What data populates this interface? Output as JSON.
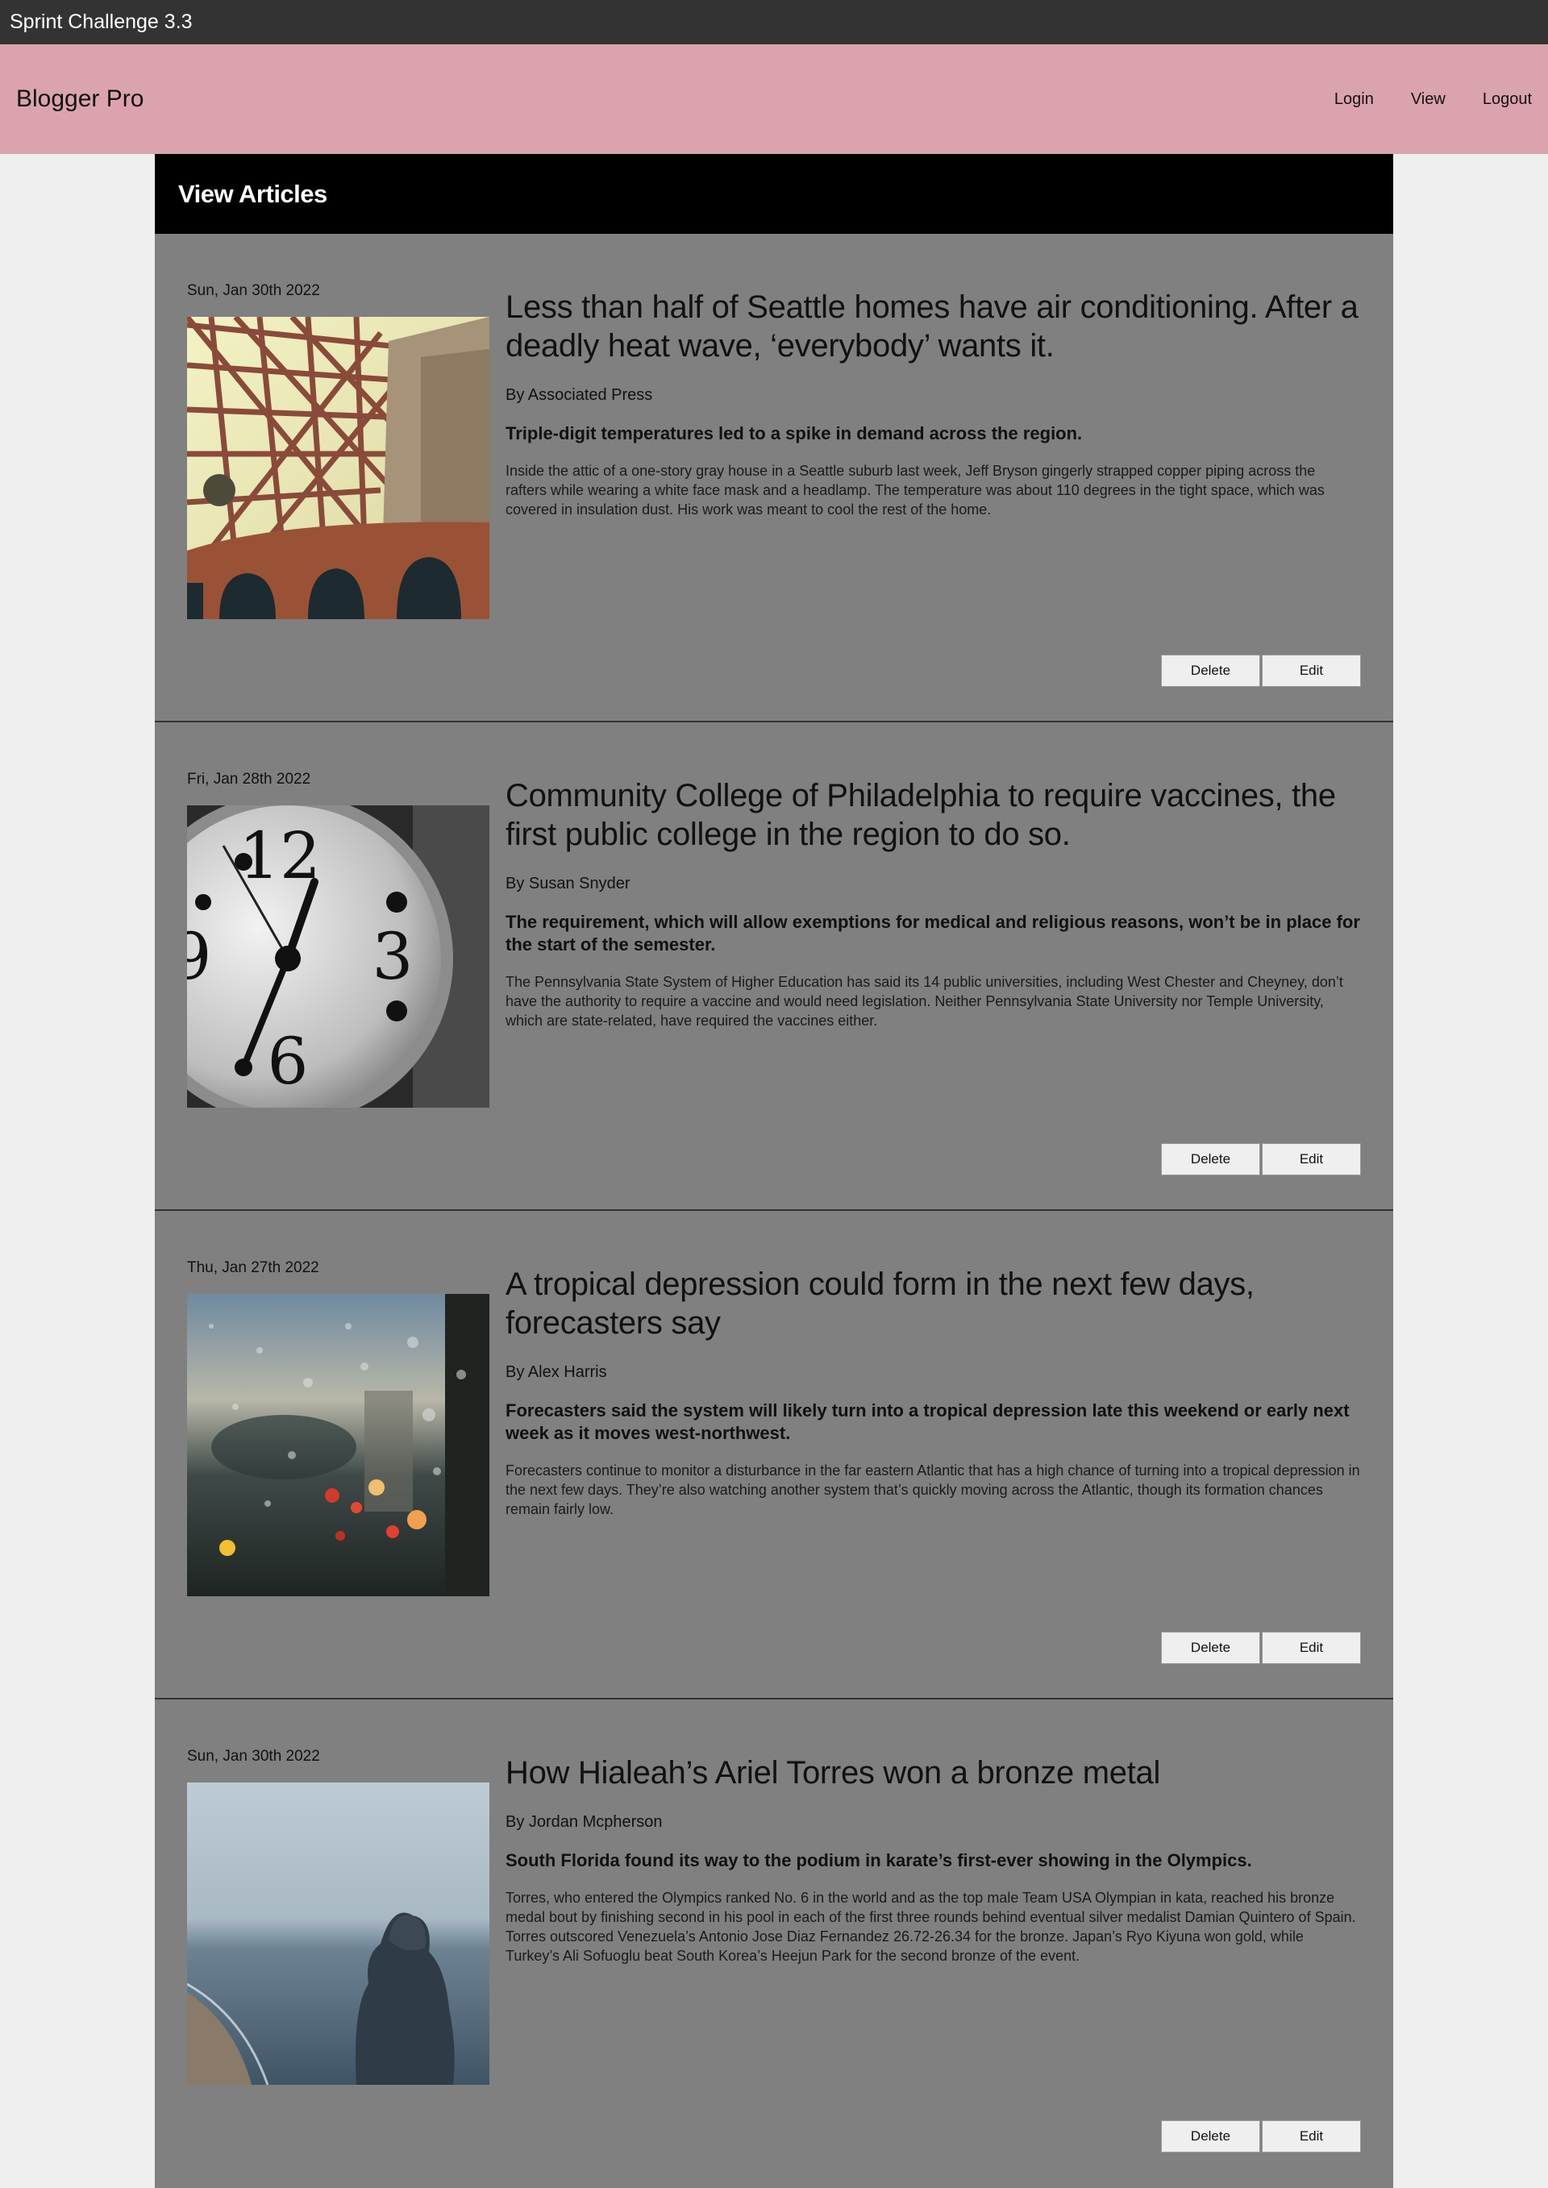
{
  "window": {
    "title": "Sprint Challenge 3.3"
  },
  "header": {
    "brand": "Blogger Pro",
    "nav": [
      "Login",
      "View",
      "Logout"
    ]
  },
  "panel": {
    "title": "View Articles"
  },
  "articles": [
    {
      "date": "Sun, Jan 30th 2022",
      "headline": "Less than half of Seattle homes have air conditioning. After a deadly heat wave, ‘everybody’ wants it.",
      "author": "By Associated Press",
      "summary": "Triple-digit temperatures led to a spike in demand across the region.",
      "body": "Inside the attic of a one-story gray house in a Seattle suburb last week, Jeff Bryson gingerly strapped copper piping across the rafters while wearing a white face mask and a headlamp. The temperature was about 110 degrees in the tight space, which was covered in insulation dust. His work was meant to cool the rest of the home.",
      "image": "bridge-steel-structure-photo"
    },
    {
      "date": "Fri, Jan 28th 2022",
      "headline": "Community College of Philadelphia to require vaccines, the first public college in the region to do so.",
      "author": "By Susan Snyder",
      "summary": "The requirement, which will allow exemptions for medical and religious reasons, won’t be in place for the start of the semester.",
      "body": "The Pennsylvania State System of Higher Education has said its 14 public universities, including West Chester and Cheyney, don’t have the authority to require a vaccine and would need legislation. Neither Pennsylvania State University nor Temple University, which are state-related, have required the vaccines either.",
      "image": "clock-face-photo"
    },
    {
      "date": "Thu, Jan 27th 2022",
      "headline": "A tropical depression could form in the next few days, forecasters say",
      "author": "By Alex Harris",
      "summary": "Forecasters said the system will likely turn into a tropical depression late this weekend or early next week as it moves west-northwest.",
      "body": "Forecasters continue to monitor a disturbance in the far eastern Atlantic that has a high chance of turning into a tropical depression in the next few days. They’re also watching another system that’s quickly moving across the Atlantic, though its formation chances remain fairly low.",
      "image": "rainy-window-photo"
    },
    {
      "date": "Sun, Jan 30th 2022",
      "headline": "How Hialeah’s Ariel Torres won a bronze metal",
      "author": "By Jordan Mcpherson",
      "summary": "South Florida found its way to the podium in karate’s first-ever showing in the Olympics.",
      "body": "Torres, who entered the Olympics ranked No. 6 in the world and as the top male Team USA Olympian in kata, reached his bronze medal bout by finishing second in his pool in each of the first three rounds behind eventual silver medalist Damian Quintero of Spain. Torres outscored Venezuela’s Antonio Jose Diaz Fernandez 26.72-26.34 for the bronze. Japan’s Ryo Kiyuna won gold, while Turkey’s Ali Sofuoglu beat South Korea’s Heejun Park for the second bronze of the event.",
      "image": "hooded-figure-beach-photo"
    }
  ],
  "buttons": {
    "delete": "Delete",
    "edit": "Edit"
  },
  "colors": {
    "titlebar": "#333333",
    "header": "#dba3ae",
    "panel_title": "#000000",
    "article_bg": "#808080",
    "page_bg": "#efefef"
  }
}
